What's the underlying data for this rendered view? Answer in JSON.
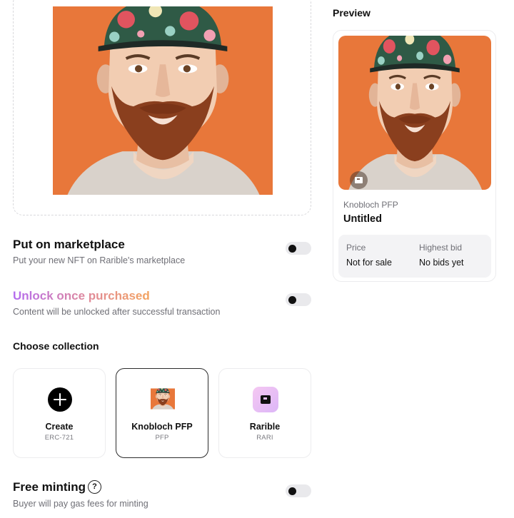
{
  "marketplace": {
    "title": "Put on marketplace",
    "subtitle": "Put your new NFT on Rarible's marketplace",
    "enabled": false
  },
  "unlock": {
    "title": "Unlock once purchased",
    "subtitle": "Content will be unlocked after successful transaction",
    "enabled": false
  },
  "collection": {
    "title": "Choose collection",
    "cards": [
      {
        "name": "Create",
        "subtitle": "ERC-721",
        "icon": "plus-icon",
        "selected": false
      },
      {
        "name": "Knobloch PFP",
        "subtitle": "PFP",
        "icon": "avatar",
        "selected": true
      },
      {
        "name": "Rarible",
        "subtitle": "RARI",
        "icon": "rarible-logo",
        "selected": false
      }
    ]
  },
  "free_minting": {
    "title": "Free minting",
    "help": "?",
    "subtitle": "Buyer will pay gas fees for minting",
    "enabled": false
  },
  "preview": {
    "heading": "Preview",
    "collection_name": "Knobloch PFP",
    "item_title": "Untitled",
    "price_label": "Price",
    "price_value": "Not for sale",
    "bid_label": "Highest bid",
    "bid_value": "No bids yet",
    "badge_icon": "rarible-badge-icon"
  },
  "colors": {
    "artwork_background": "#e8773a",
    "accent_gradient": [
      "#b46cf0",
      "#e08a9a",
      "#f4a35d"
    ],
    "toggle_off": "#e9e9ec"
  }
}
